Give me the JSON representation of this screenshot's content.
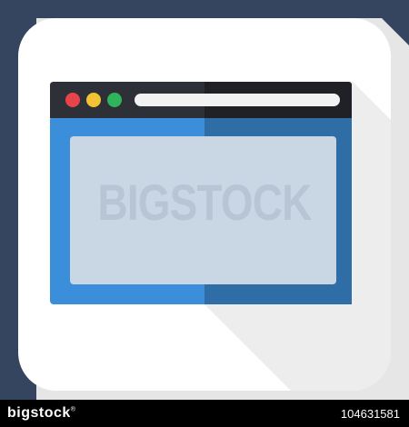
{
  "illustration": {
    "subject": "browser-window-icon",
    "colors": {
      "background": "#354560",
      "long_shadow": "#e6e6e6",
      "card": "#ffffff",
      "title_bar": "#2d3037",
      "title_bar_shadow": "#1f2127",
      "address_bar": "#f2f2f2",
      "dot_red": "#e8434a",
      "dot_yellow": "#f1c232",
      "dot_green": "#2fb35b",
      "window_body": "#3b8ed9",
      "window_body_shadow": "#2e6da6",
      "content_pane": "#c9d6e4"
    }
  },
  "watermark": {
    "text": "BIGSTOCK"
  },
  "footer": {
    "logo": "bigstock",
    "trademark": "®",
    "image_id": "104631581"
  }
}
